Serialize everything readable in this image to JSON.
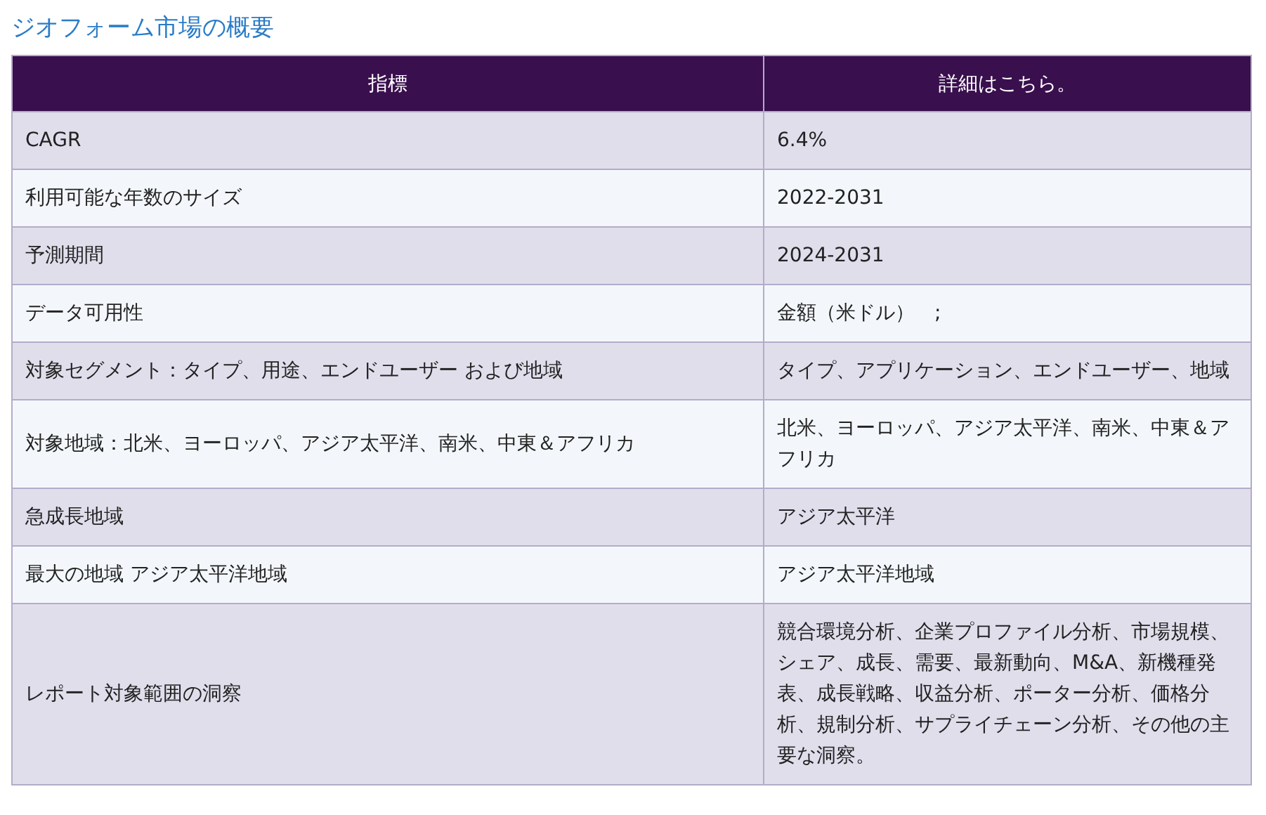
{
  "title": "ジオフォーム市場の概要",
  "table": {
    "columns": [
      "指標",
      "詳細はこちら。"
    ],
    "rows": [
      [
        "CAGR",
        "6.4%"
      ],
      [
        "利用可能な年数のサイズ",
        "2022-2031"
      ],
      [
        "予測期間",
        "2024-2031"
      ],
      [
        "データ可用性",
        "金額（米ドル）　;"
      ],
      [
        "対象セグメント：タイプ、用途、エンドユーザー および地域",
        "タイプ、アプリケーション、エンドユーザー、地域"
      ],
      [
        "対象地域：北米、ヨーロッパ、アジア太平洋、南米、中東＆アフリカ",
        "北米、ヨーロッパ、アジア太平洋、南米、中東＆アフリカ"
      ],
      [
        "急成長地域",
        "アジア太平洋"
      ],
      [
        "最大の地域 アジア太平洋地域",
        "アジア太平洋地域"
      ],
      [
        "レポート対象範囲の洞察",
        "競合環境分析、企業プロファイル分析、市場規模、シェア、成長、需要、最新動向、M&A、新機種発表、成長戦略、収益分析、ポーター分析、価格分析、規制分析、サプライチェーン分析、その他の主要な洞察。"
      ]
    ]
  }
}
